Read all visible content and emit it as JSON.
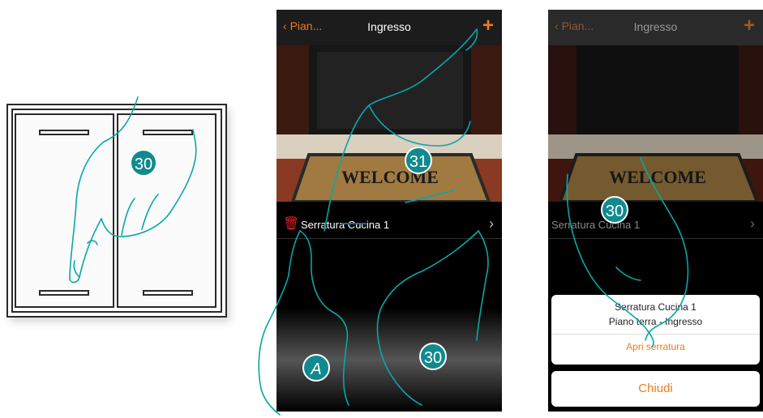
{
  "colors": {
    "accent_orange": "#f07a1f",
    "badge_teal": "#108a8f",
    "hand_outline": "#0aa6a8",
    "delete_red": "#e02020"
  },
  "panel_switch": {
    "step_badge": "30"
  },
  "phone1": {
    "nav": {
      "back_label": "Pian...",
      "title": "Ingresso",
      "add_icon": "plus-icon"
    },
    "photo": {
      "doormat_text": "WELCOME"
    },
    "row": {
      "label": "Serratura Cucina 1",
      "delete_icon": "trash-icon",
      "chevron_icon": "chevron-right-icon"
    },
    "badges": {
      "add": "31",
      "delete": "A",
      "open": "30"
    }
  },
  "phone2": {
    "nav": {
      "back_label": "Pian...",
      "title": "Ingresso",
      "add_icon": "plus-icon"
    },
    "photo": {
      "doormat_text": "WELCOME"
    },
    "row": {
      "label": "Serratura Cucina 1",
      "chevron_icon": "chevron-right-icon"
    },
    "badge": "30",
    "sheet": {
      "title": "Serratura Cucina 1",
      "subtitle": "Piano terra - Ingresso",
      "action": "Apri serratura",
      "close": "Chiudi"
    }
  }
}
